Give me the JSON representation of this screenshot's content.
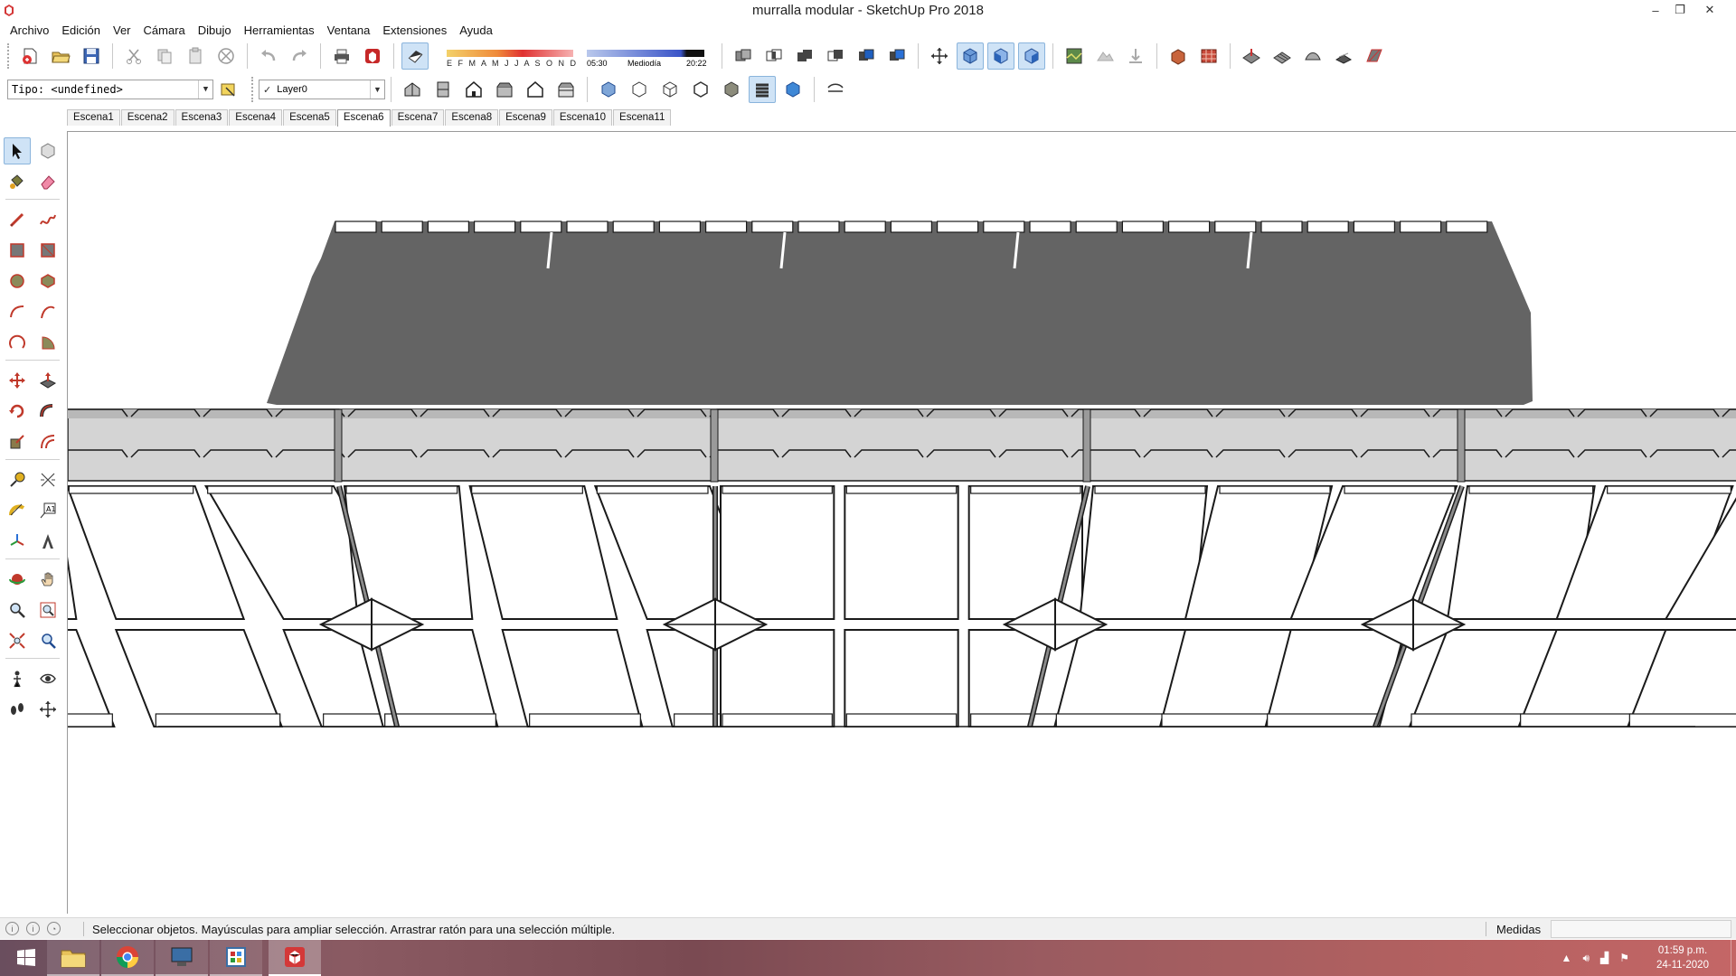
{
  "window": {
    "title": "murralla modular - SketchUp Pro 2018",
    "minimize": "–",
    "restore": "❐",
    "close": "✕"
  },
  "menu": [
    "Archivo",
    "Edición",
    "Ver",
    "Cámara",
    "Dibujo",
    "Herramientas",
    "Ventana",
    "Extensiones",
    "Ayuda"
  ],
  "toolbar1": {
    "shadow": {
      "months": "E F M A M J J A S O N D",
      "time_start": "05:30",
      "time_mid": "Mediodía",
      "time_end": "20:22"
    }
  },
  "toolbar2": {
    "type_value": "Tipo: <undefined>",
    "layer_value": "Layer0",
    "layer_check": "✓"
  },
  "scenes": {
    "tabs": [
      "Escena1",
      "Escena2",
      "Escena3",
      "Escena4",
      "Escena5",
      "Escena6",
      "Escena7",
      "Escena8",
      "Escena9",
      "Escena10",
      "Escena11"
    ],
    "active_index": 5
  },
  "status": {
    "text": "Seleccionar objetos. Mayúsculas para ampliar selección. Arrastrar ratón para una selección múltiple.",
    "measure_label": "Medidas",
    "measure_value": ""
  },
  "taskbar": {
    "time": "01:59 p.m.",
    "date": "24-11-2020"
  },
  "colors": {
    "wall_face": "#646464",
    "slab": "#d3d3d3",
    "accent": "#3a8ee6"
  }
}
